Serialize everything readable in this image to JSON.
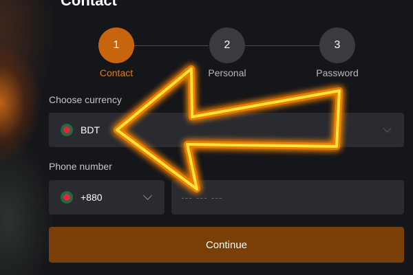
{
  "header": {
    "title": "Contact"
  },
  "stepper": {
    "steps": [
      {
        "number": "1",
        "label": "Contact",
        "active": true
      },
      {
        "number": "2",
        "label": "Personal",
        "active": false
      },
      {
        "number": "3",
        "label": "Password",
        "active": false
      }
    ]
  },
  "currency": {
    "label": "Choose currency",
    "selected": "BDT",
    "flag_icon": "bangladesh-flag-icon"
  },
  "phone": {
    "label": "Phone number",
    "country_code": "+880",
    "flag_icon": "bangladesh-flag-icon",
    "placeholder": "--- --- ---",
    "value": ""
  },
  "actions": {
    "continue_label": "Continue"
  },
  "colors": {
    "accent": "#c7650f",
    "button_bg": "#7a3f06",
    "panel_bg": "#15161a",
    "field_bg": "#2a2b30",
    "highlight_arrow": "#ffd400"
  }
}
